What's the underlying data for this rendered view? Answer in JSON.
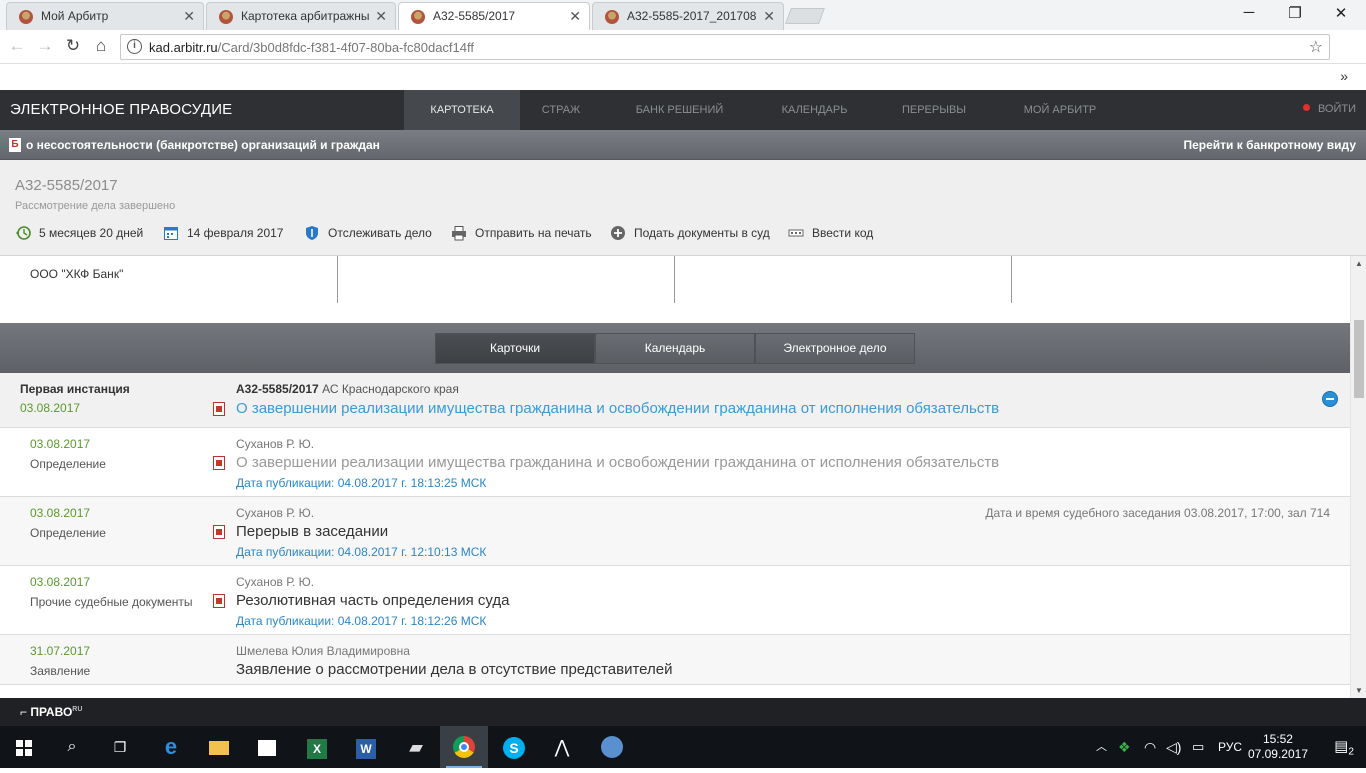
{
  "browser": {
    "tabs": [
      {
        "title": "Мой Арбитр",
        "active": false
      },
      {
        "title": "Картотека арбитражны",
        "active": false
      },
      {
        "title": "А32-5585/2017",
        "active": true
      },
      {
        "title": "А32-5585-2017_201708",
        "active": false
      }
    ],
    "url_host": "kad.arbitr.ru",
    "url_path": "/Card/3b0d8fdc-f381-4f07-80ba-fc80dacf14ff",
    "more_bookmarks": "»"
  },
  "site": {
    "brand": "ЭЛЕКТРОННОЕ ПРАВОСУДИЕ",
    "nav": [
      "КАРТОТЕКА",
      "СТРАЖ",
      "БАНК РЕШЕНИЙ",
      "КАЛЕНДАРЬ",
      "ПЕРЕРЫВЫ",
      "МОЙ АРБИТР"
    ],
    "login": "ВОЙТИ"
  },
  "bankruptcy": {
    "icon": "Б",
    "title": "о несостоятельности (банкротстве) организаций и граждан",
    "link": "Перейти к банкротному виду"
  },
  "case": {
    "number": "А32-5585/2017",
    "status": "Рассмотрение дела завершено",
    "actions": [
      {
        "icon": "clock-back-icon",
        "label": "5 месяцев 20 дней"
      },
      {
        "icon": "calendar-icon",
        "label": "14 февраля 2017"
      },
      {
        "icon": "shield-icon",
        "label": "Отслеживать дело"
      },
      {
        "icon": "printer-icon",
        "label": "Отправить на печать"
      },
      {
        "icon": "plus-circle-icon",
        "label": "Подать документы в суд"
      },
      {
        "icon": "code-icon",
        "label": "Ввести код"
      }
    ],
    "participant": "ООО \"ХКФ Банк\""
  },
  "card_tabs": [
    "Карточки",
    "Календарь",
    "Электронное дело"
  ],
  "instance": {
    "label": "Первая инстанция",
    "date": "03.08.2017",
    "case_ref": "А32-5585/2017",
    "court": "АС Краснодарского края",
    "title": "О завершении реализации имущества гражданина и освобождении гражданина от исполнения обязательств"
  },
  "documents": [
    {
      "date": "03.08.2017",
      "type": "Определение",
      "judge": "Суханов Р. Ю.",
      "title": "О завершении реализации имущества гражданина и освобождении гражданина от исполнения обязательств",
      "pub": "Дата публикации: 04.08.2017 г. 18:13:25 МСК",
      "right": ""
    },
    {
      "date": "03.08.2017",
      "type": "Определение",
      "judge": "Суханов Р. Ю.",
      "title": "Перерыв в заседании",
      "pub": "Дата публикации: 04.08.2017 г. 12:10:13 МСК",
      "right": "Дата и время судебного заседания 03.08.2017, 17:00, зал 714"
    },
    {
      "date": "03.08.2017",
      "type": "Прочие судебные документы",
      "judge": "Суханов Р. Ю.",
      "title": "Резолютивная часть определения суда",
      "pub": "Дата публикации: 04.08.2017 г. 18:12:26 МСК",
      "right": ""
    },
    {
      "date": "31.07.2017",
      "type": "Заявление",
      "judge": "Шмелева Юлия Владимировна",
      "title": "Заявление о рассмотрении дела в отсутствие представителей",
      "pub": "",
      "right": ""
    }
  ],
  "pravo": {
    "logo": "ПРАВО",
    "sup": "RU"
  },
  "taskbar": {
    "lang": "РУС",
    "time": "15:52",
    "date": "07.09.2017",
    "notifications": "2"
  }
}
